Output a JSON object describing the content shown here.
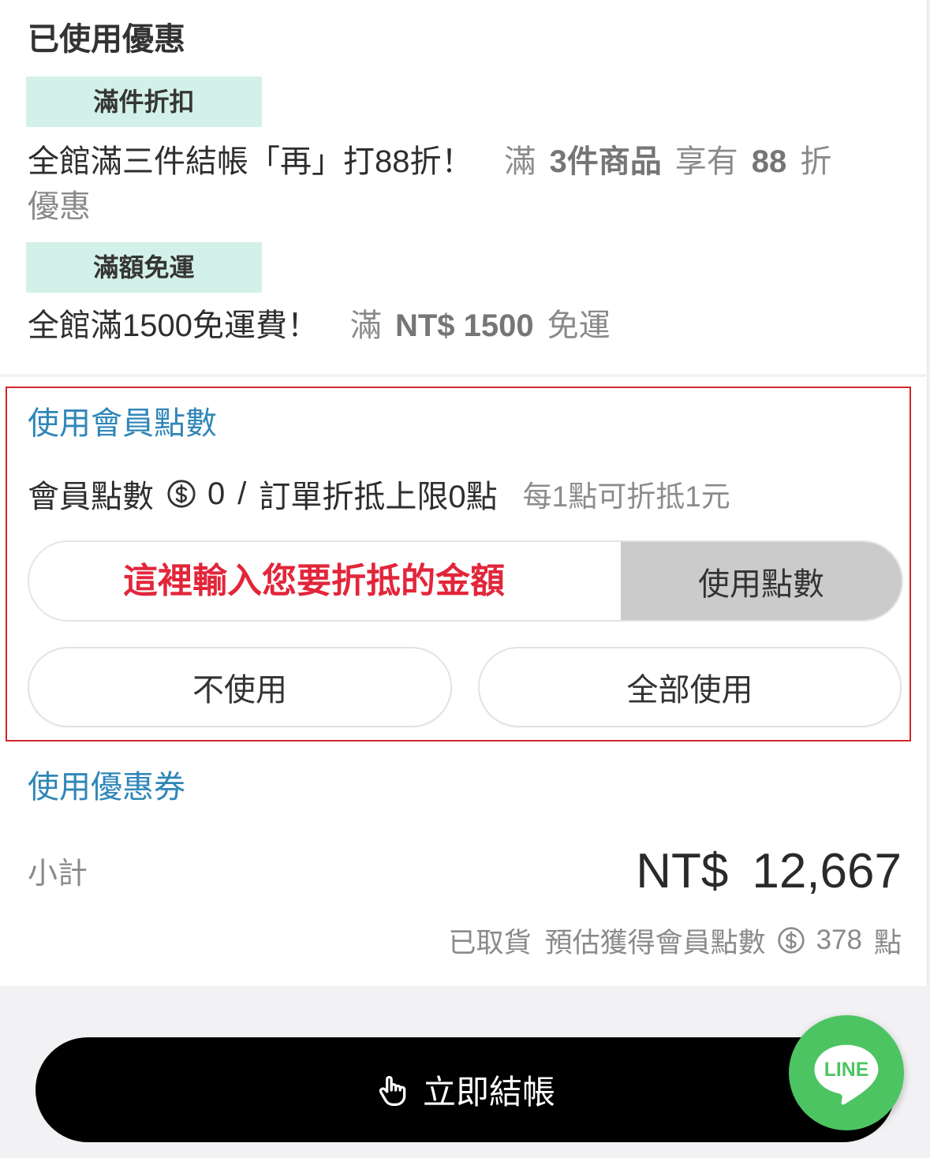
{
  "applied_offers": {
    "title": "已使用優惠",
    "offers": [
      {
        "tag": "滿件折扣",
        "title": "全館滿三件結帳「再」打88折！",
        "condition": {
          "lead": "滿",
          "threshold": "3件商品",
          "verb": "享有",
          "value": "88",
          "unit": "折",
          "tail": "優惠"
        }
      },
      {
        "tag": "滿額免運",
        "title": "全館滿1500免運費！",
        "condition": {
          "lead": "滿",
          "threshold": "NT$ 1500",
          "benefit": "免運"
        }
      }
    ]
  },
  "member_points": {
    "title": "使用會員點數",
    "label": "會員點數",
    "coin_icon": "dollar-coin-icon",
    "balance": "0",
    "separator": "/",
    "limit_text": "訂單折抵上限0點",
    "rate_note": "每1點可折抵1元",
    "input_placeholder": "這裡輸入您要折抵的金額",
    "apply_button": "使用點數",
    "none_button": "不使用",
    "all_button": "全部使用"
  },
  "coupon": {
    "title": "使用優惠券"
  },
  "subtotal": {
    "label": "小計",
    "currency": "NT$",
    "amount": "12,667",
    "status": "已取貨",
    "estimate_label": "預估獲得會員點數",
    "estimate_points": "378",
    "points_unit": "點"
  },
  "checkout": {
    "label": "立即結帳",
    "icon": "hand-pointer-icon"
  },
  "line_chat": {
    "label": "LINE",
    "icon": "line-chat-icon"
  },
  "colors": {
    "accent_blue": "#2f86b8",
    "tag_background": "#d4f1e9",
    "highlight_red": "#e2263a",
    "annotation_border": "#d0282d",
    "apply_button_background": "#cbcbcb",
    "checkout_background": "#000000",
    "line_green": "#4cc462"
  }
}
